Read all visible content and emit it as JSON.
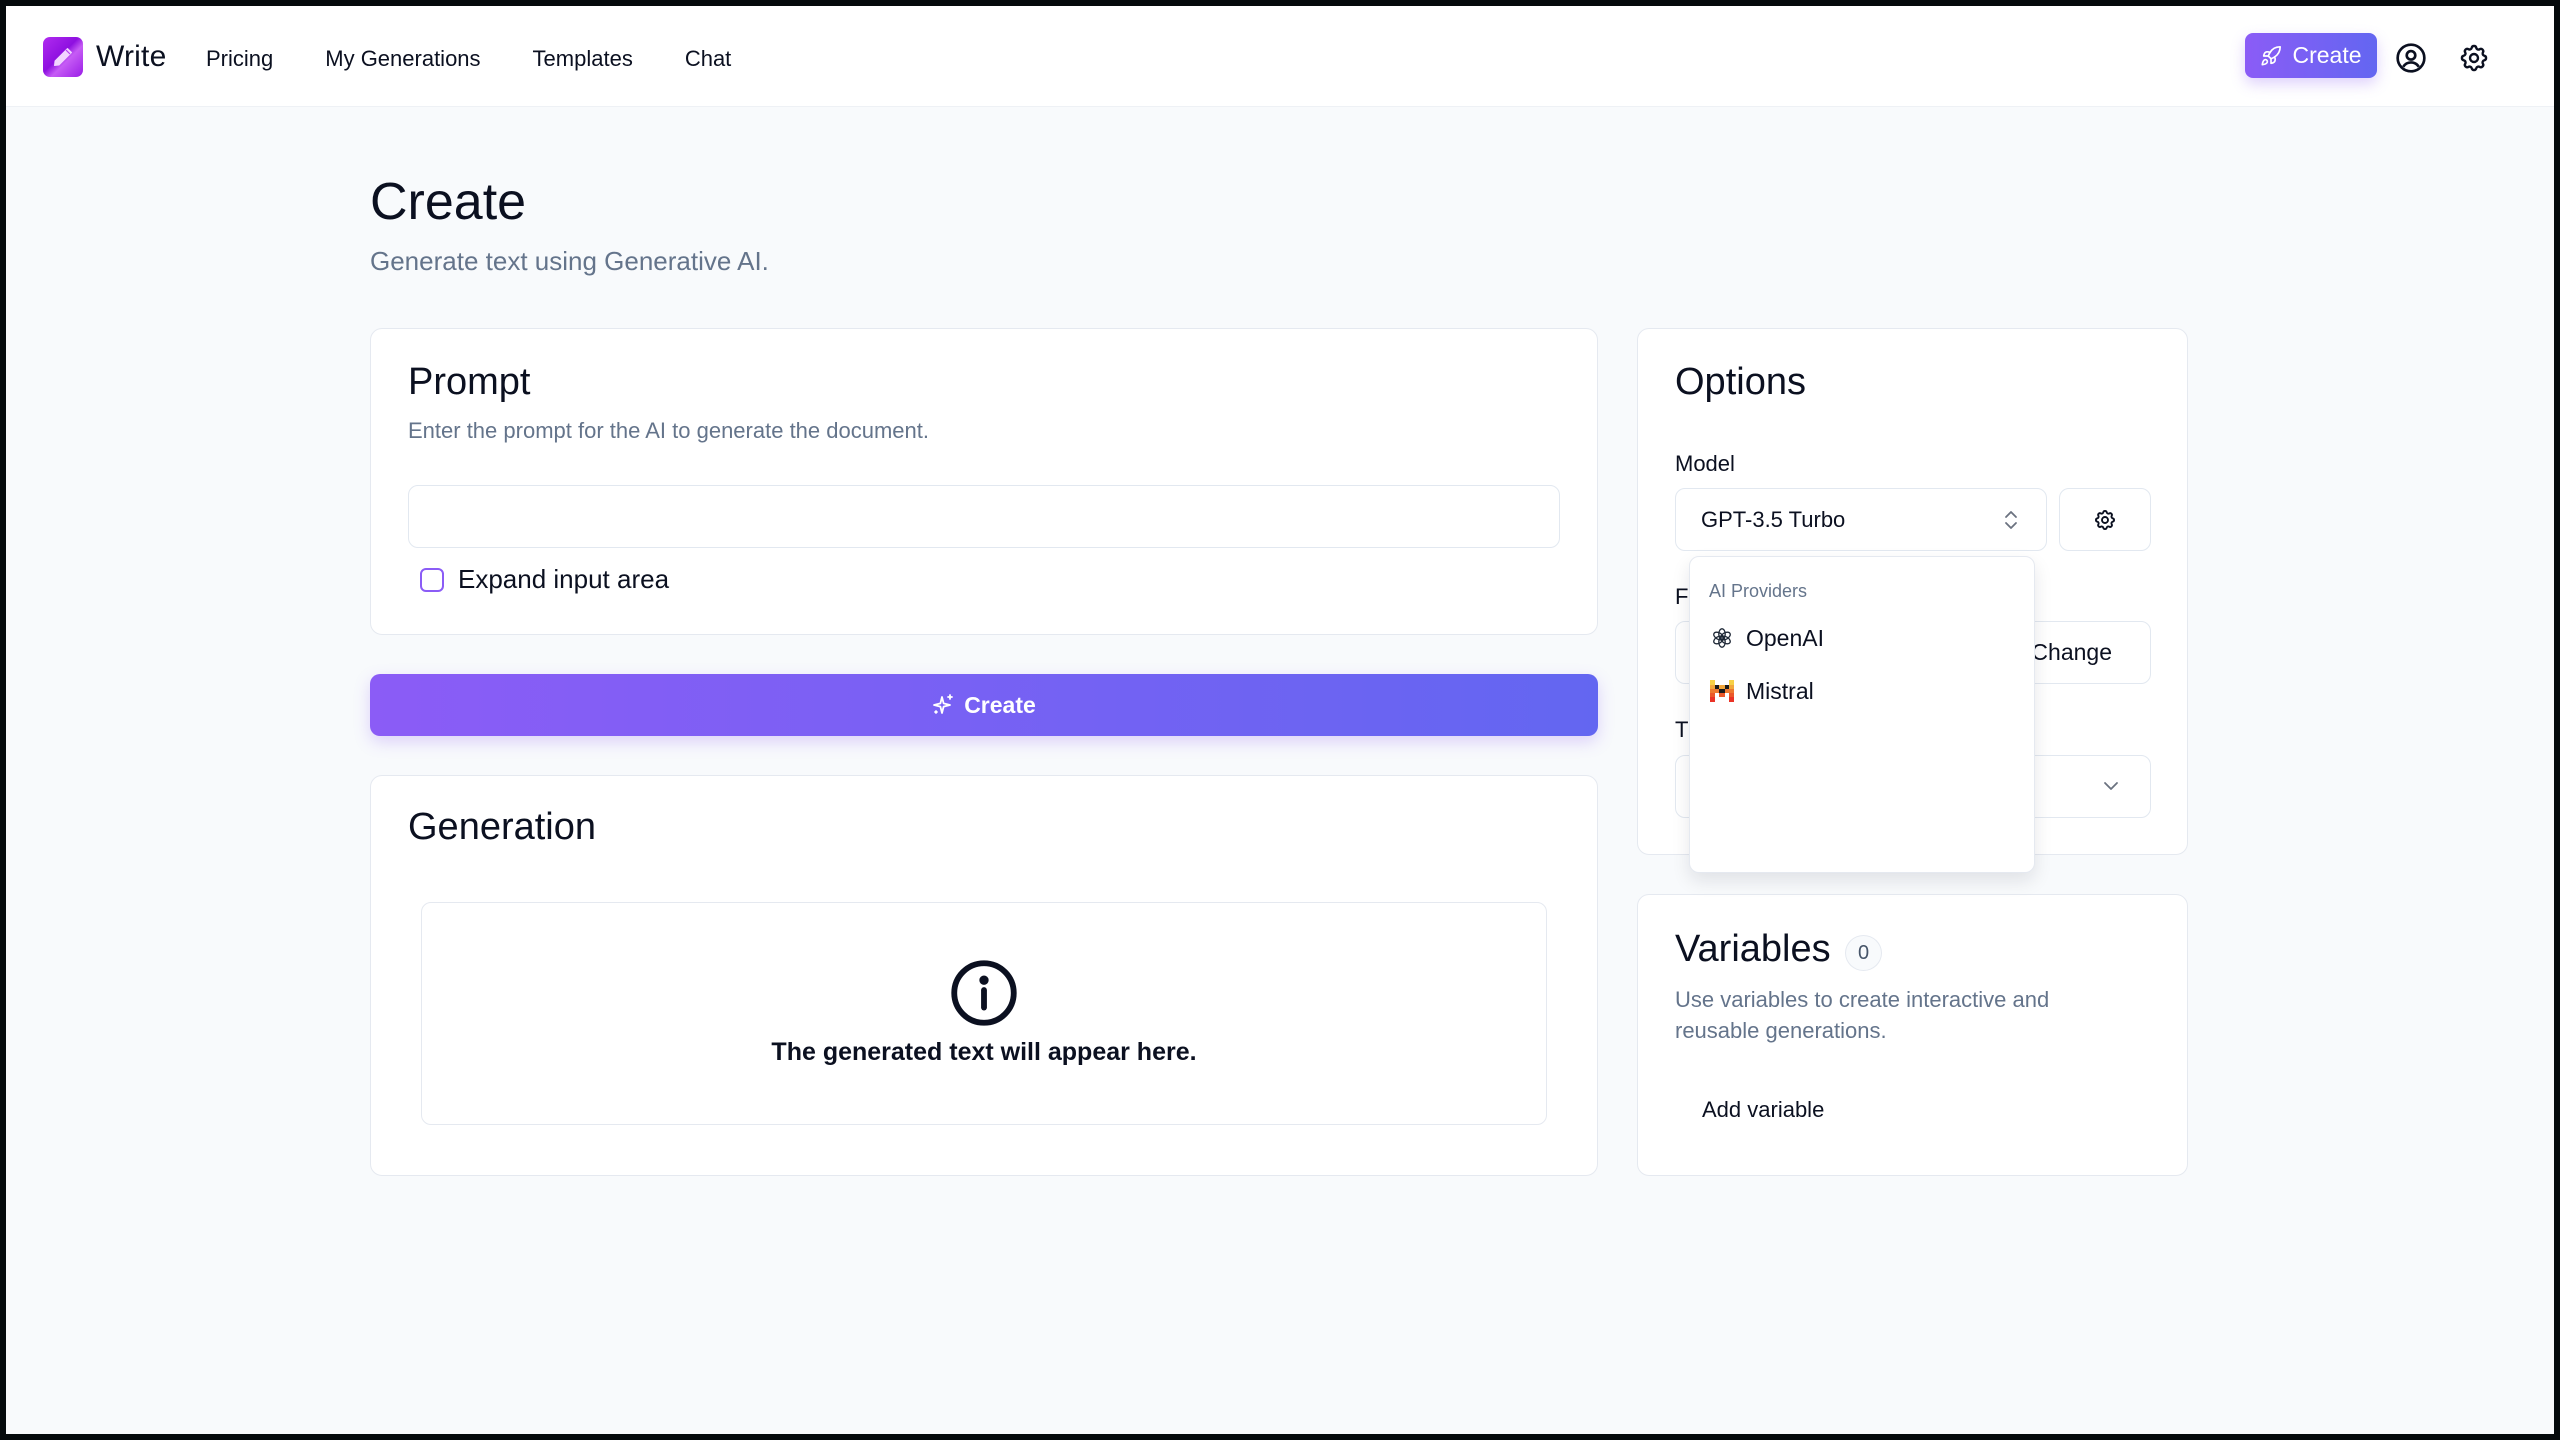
{
  "header": {
    "brand": "Write",
    "nav": [
      {
        "label": "Pricing"
      },
      {
        "label": "My Generations"
      },
      {
        "label": "Templates"
      },
      {
        "label": "Chat"
      }
    ],
    "create_label": "Create",
    "icons": [
      "rocket-icon",
      "user-circle-icon",
      "gear-icon"
    ]
  },
  "page": {
    "title": "Create",
    "subtitle": "Generate text using Generative AI."
  },
  "prompt": {
    "title": "Prompt",
    "description": "Enter the prompt for the AI to generate the document.",
    "input_value": "",
    "expand_label": "Expand input area",
    "expand_checked": false
  },
  "create_button": {
    "label": "Create",
    "icon": "sparkles-icon"
  },
  "generation": {
    "title": "Generation",
    "empty_text": "The generated text will appear here.",
    "icon": "info-icon"
  },
  "options": {
    "title": "Options",
    "model_label": "Model",
    "model_value": "GPT-3.5 Turbo",
    "second_label_visible": "F",
    "change_label": "Change",
    "third_label_visible": "T",
    "third_select_value": ""
  },
  "dropdown": {
    "group_label": "AI Providers",
    "items": [
      {
        "label": "OpenAI",
        "icon": "openai-icon"
      },
      {
        "label": "Mistral",
        "icon": "mistral-icon"
      }
    ]
  },
  "variables": {
    "title": "Variables",
    "count": "0",
    "description": "Use variables to create interactive and reusable generations.",
    "add_label": "Add variable"
  },
  "colors": {
    "accent_start": "#8b5cf6",
    "accent_end": "#6366f1",
    "page_bg": "#f8fafc",
    "muted_text": "#64748b",
    "text": "#0b1020"
  }
}
